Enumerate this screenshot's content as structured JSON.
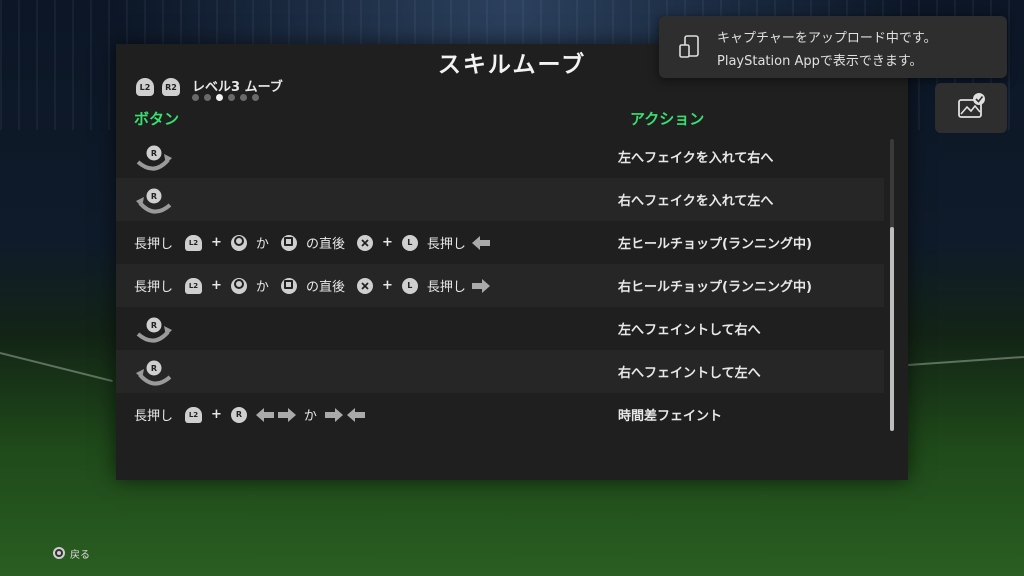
{
  "panel": {
    "title": "スキルムーブ",
    "level_label": "レベル3 ムーブ",
    "level_page_count": 6,
    "level_active_index": 2,
    "trigger_left": "L2",
    "trigger_right": "R2",
    "header_button": "ボタン",
    "header_action": "アクション",
    "stick_r": "R",
    "stick_l": "L",
    "trig_l2": "L2",
    "hold": "長押し",
    "or": "か",
    "right_after": "の直後",
    "plus": "+",
    "rows": [
      {
        "action": "左へフェイクを入れて右へ"
      },
      {
        "action": "右へフェイクを入れて左へ"
      },
      {
        "action": "左ヒールチョップ(ランニング中)"
      },
      {
        "action": "右ヒールチョップ(ランニング中)"
      },
      {
        "action": "左へフェイントして右へ"
      },
      {
        "action": "右へフェイントして左へ"
      },
      {
        "action": "時間差フェイント"
      }
    ]
  },
  "toast": {
    "line1": "キャプチャーをアップロード中です。",
    "line2": "PlayStation Appで表示できます。"
  },
  "footer": {
    "back_label": "戻る"
  },
  "colors": {
    "accent_green": "#39e06f",
    "panel_bg": "#1f1f1f"
  }
}
